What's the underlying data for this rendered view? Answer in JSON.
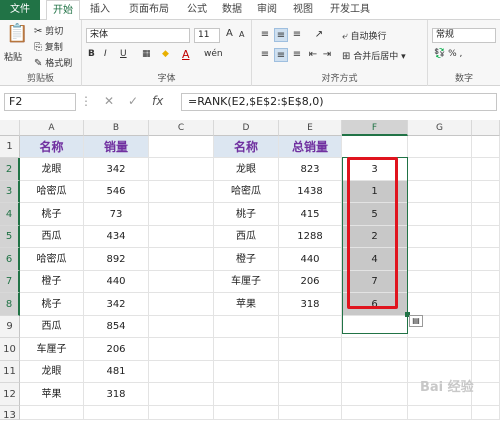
{
  "tabs": [
    "文件",
    "开始",
    "插入",
    "页面布局",
    "公式",
    "数据",
    "审阅",
    "视图",
    "开发工具"
  ],
  "ribbon": {
    "clipboard": {
      "paste": "粘贴",
      "cut": "剪切",
      "copy": "复制",
      "format_painter": "格式刷",
      "label": "剪贴板"
    },
    "font": {
      "name": "宋体",
      "size": "11",
      "grow": "A",
      "shrink": "A",
      "bold": "B",
      "italic": "I",
      "underline": "U",
      "color_a": "A",
      "wen": "wén",
      "label": "字体"
    },
    "align": {
      "wrap": "自动换行",
      "merge": "合并后居中",
      "label": "对齐方式"
    },
    "number": {
      "format": "常规",
      "label": "数字"
    }
  },
  "formula_bar": {
    "cell_ref": "F2",
    "fx": "fx",
    "formula": "=RANK(E2,$E$2:$E$8,0)"
  },
  "columns": [
    "A",
    "B",
    "C",
    "D",
    "E",
    "F",
    "G"
  ],
  "rows": [
    "1",
    "2",
    "3",
    "4",
    "5",
    "6",
    "7",
    "8",
    "9",
    "10",
    "11",
    "12",
    "13"
  ],
  "table1": {
    "headers": [
      "名称",
      "销量"
    ],
    "rows": [
      [
        "龙眼",
        "342"
      ],
      [
        "哈密瓜",
        "546"
      ],
      [
        "桃子",
        "73"
      ],
      [
        "西瓜",
        "434"
      ],
      [
        "哈密瓜",
        "892"
      ],
      [
        "橙子",
        "440"
      ],
      [
        "桃子",
        "342"
      ],
      [
        "西瓜",
        "854"
      ],
      [
        "车厘子",
        "206"
      ],
      [
        "龙眼",
        "481"
      ],
      [
        "苹果",
        "318"
      ]
    ]
  },
  "table2": {
    "headers": [
      "名称",
      "总销量"
    ],
    "rows": [
      [
        "龙眼",
        "823",
        "3"
      ],
      [
        "哈密瓜",
        "1438",
        "1"
      ],
      [
        "桃子",
        "415",
        "5"
      ],
      [
        "西瓜",
        "1288",
        "2"
      ],
      [
        "橙子",
        "440",
        "4"
      ],
      [
        "车厘子",
        "206",
        "7"
      ],
      [
        "苹果",
        "318",
        "6"
      ]
    ]
  },
  "watermark": "Bai 经验",
  "colors": {
    "accent": "#217346",
    "header_fill": "#dce6f1",
    "header_text": "#7030a0",
    "highlight": "#e0141e"
  }
}
